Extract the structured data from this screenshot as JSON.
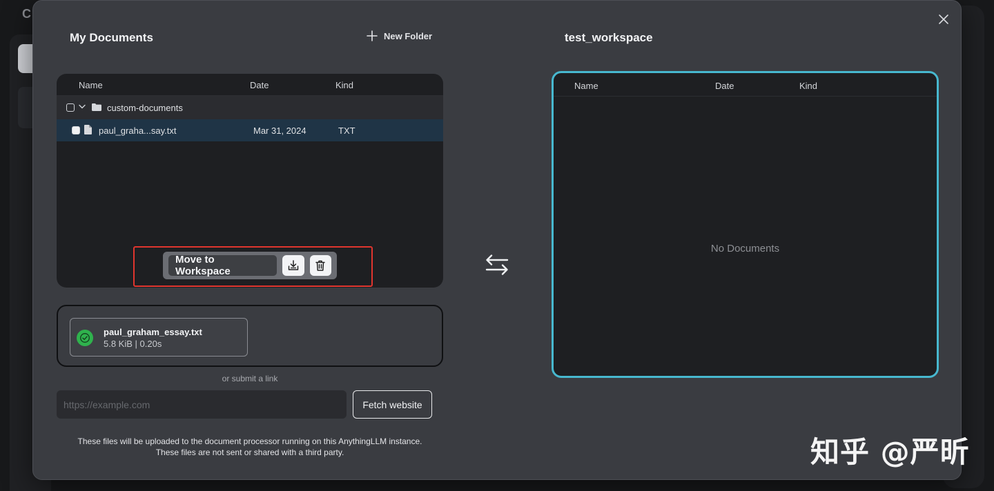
{
  "background": {
    "logo_char": "C"
  },
  "modal": {
    "left": {
      "title": "My Documents",
      "new_folder_label": "New Folder",
      "table": {
        "columns": [
          "Name",
          "Date",
          "Kind"
        ],
        "folder": {
          "name": "custom-documents"
        },
        "files": [
          {
            "name": "paul_graha...say.txt",
            "date": "Mar 31, 2024",
            "kind": "TXT"
          }
        ]
      },
      "actions": {
        "move_label": "Move to Workspace"
      },
      "upload": {
        "file_name": "paul_graham_essay.txt",
        "file_meta": "5.8 KiB | 0.20s"
      },
      "link": {
        "or_label": "or submit a link",
        "placeholder": "https://example.com",
        "fetch_label": "Fetch website"
      },
      "disclaimer_line1": "These files will be uploaded to the document processor running on this AnythingLLM instance.",
      "disclaimer_line2": "These files are not sent or shared with a third party."
    },
    "right": {
      "title": "test_workspace",
      "columns": [
        "Name",
        "Date",
        "Kind"
      ],
      "empty_label": "No Documents"
    }
  },
  "watermark": "知乎 @严昕",
  "colors": {
    "highlight": "#e0352e",
    "workspace_border": "#47b8cf",
    "success": "#2fb24d",
    "selected_row": "#1f3446"
  }
}
